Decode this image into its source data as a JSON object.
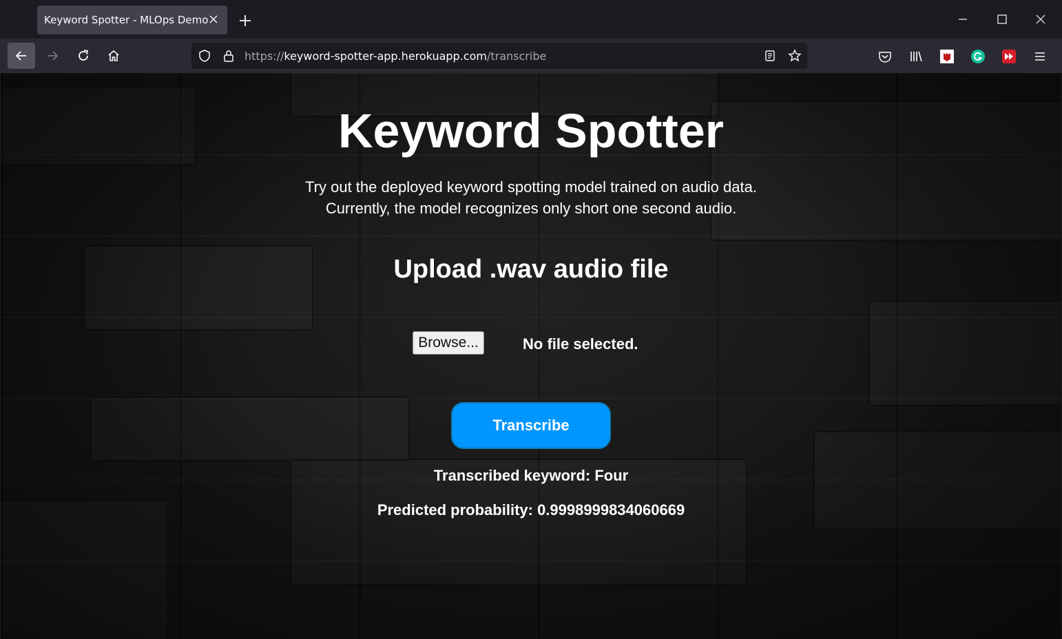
{
  "browser": {
    "tab_title": "Keyword Spotter - MLOps Demo",
    "url_scheme": "https://",
    "url_host": "keyword-spotter-app.herokuapp.com",
    "url_path": "/transcribe"
  },
  "page": {
    "title": "Keyword Spotter",
    "subtitle_line1": "Try out the deployed keyword spotting model trained on audio data.",
    "subtitle_line2": "Currently, the model recognizes only short one second audio.",
    "upload_heading": "Upload .wav audio file",
    "browse_label": "Browse...",
    "file_status": "No file selected.",
    "transcribe_label": "Transcribe",
    "transcribed_keyword": "Transcribed keyword: Four",
    "predicted_probability": "Predicted probability: 0.9998999834060669"
  },
  "colors": {
    "accent_button": "#0096ff",
    "browser_frame": "#1c1b22",
    "toolbar": "#2b2a33"
  }
}
